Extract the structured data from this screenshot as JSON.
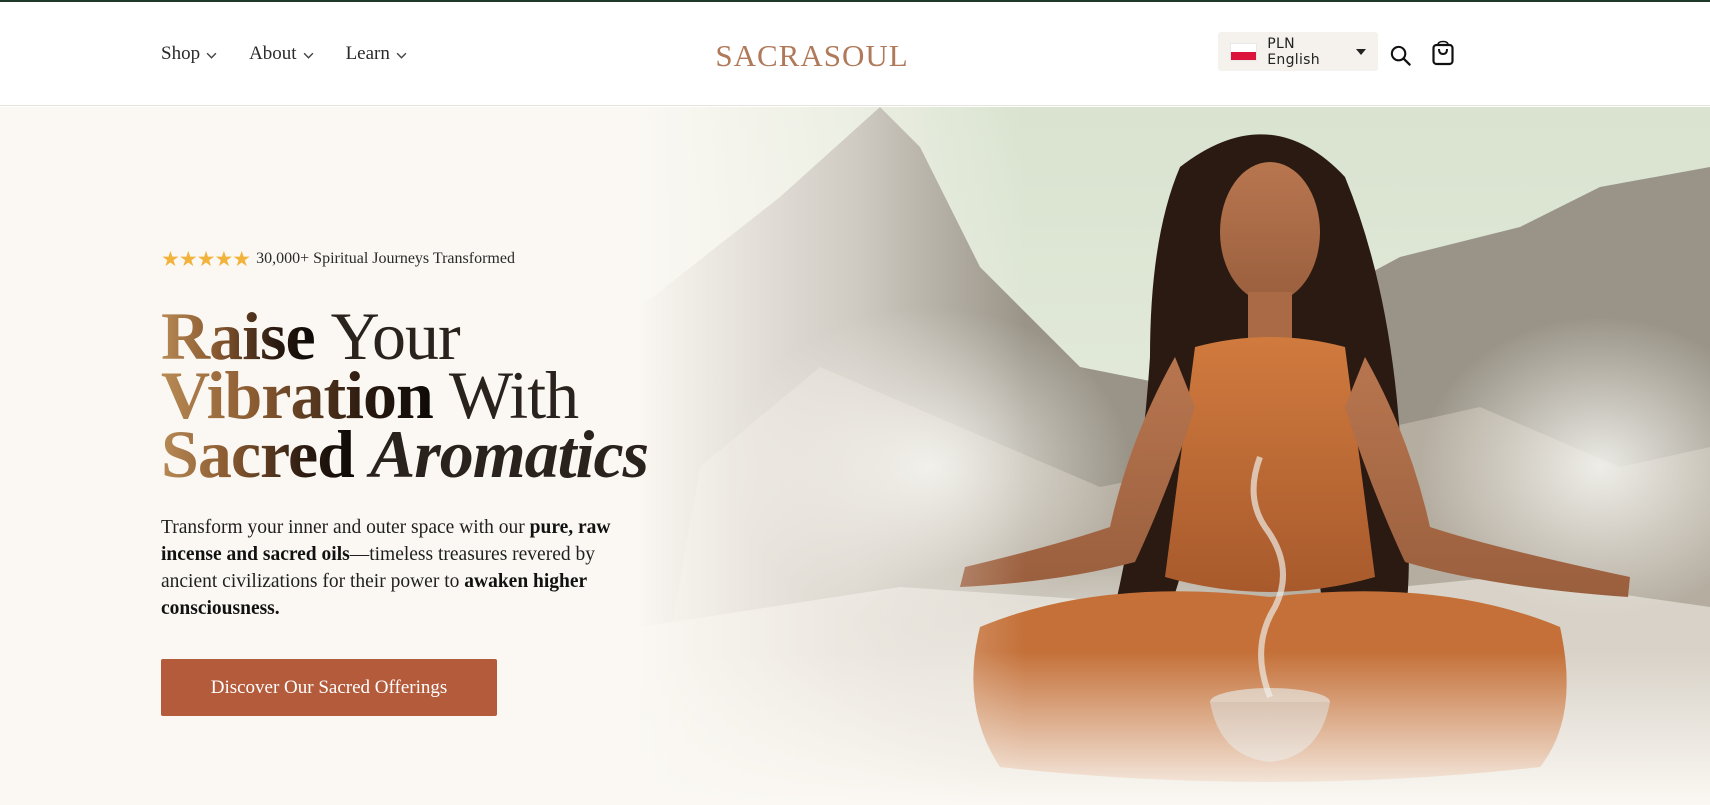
{
  "header": {
    "nav": [
      {
        "label": "Shop"
      },
      {
        "label": "About"
      },
      {
        "label": "Learn"
      }
    ],
    "logo_text": "SACRASOUL",
    "locale": {
      "label": "PLN English",
      "flag_colors": [
        "#ffffff",
        "#dc143c"
      ]
    },
    "icons": {
      "search": "search-icon",
      "cart": "cart-icon"
    }
  },
  "hero": {
    "rating": {
      "stars": "★★★★★",
      "text": "30,000+ Spiritual Journeys Transformed"
    },
    "headline": {
      "line1_bold": "Raise",
      "line1_light": "Your",
      "line2_bold": "Vibration",
      "line2_light": "With",
      "line3_bold": "Sacred",
      "line3_italic": "Aromatics"
    },
    "body": {
      "part1": "Transform your inner and outer space with our ",
      "bold1": "pure, raw incense and sacred oils",
      "part2": "—timeless treasures revered by ancient civilizations for their power to ",
      "bold2": "awaken higher consciousness."
    },
    "cta_label": "Discover Our Sacred Offerings"
  },
  "colors": {
    "accent": "#b45b3c",
    "star": "#f2b33d",
    "logo": "#b07a5a",
    "hero_bg": "#fbf8f3"
  }
}
